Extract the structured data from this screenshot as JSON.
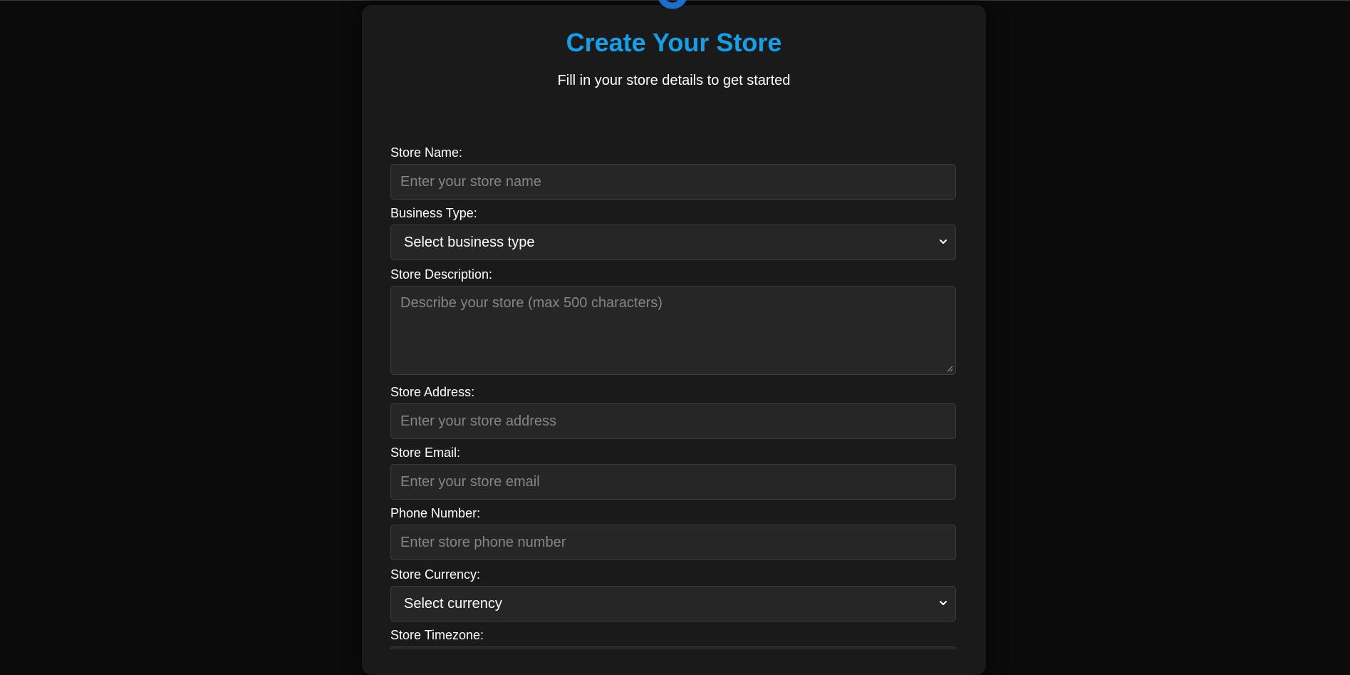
{
  "header": {
    "title": "Create Your Store",
    "subtitle": "Fill in your store details to get started"
  },
  "form": {
    "store_name": {
      "label": "Store Name:",
      "placeholder": "Enter your store name"
    },
    "business_type": {
      "label": "Business Type:",
      "selected": "Select business type"
    },
    "store_description": {
      "label": "Store Description:",
      "placeholder": "Describe your store (max 500 characters)"
    },
    "store_address": {
      "label": "Store Address:",
      "placeholder": "Enter your store address"
    },
    "store_email": {
      "label": "Store Email:",
      "placeholder": "Enter your store email"
    },
    "phone_number": {
      "label": "Phone Number:",
      "placeholder": "Enter store phone number"
    },
    "store_currency": {
      "label": "Store Currency:",
      "selected": "Select currency"
    },
    "store_timezone": {
      "label": "Store Timezone:"
    }
  },
  "colors": {
    "page_background": "#0b0b0b",
    "card_background": "#1a1a1a",
    "field_background": "#262626",
    "accent": "#12a0e8",
    "placeholder": "#858585"
  },
  "icons": {
    "logo": "store-logo-icon",
    "select_arrow": "chevron-down-icon",
    "textarea_grip": "resize-grip-icon"
  }
}
